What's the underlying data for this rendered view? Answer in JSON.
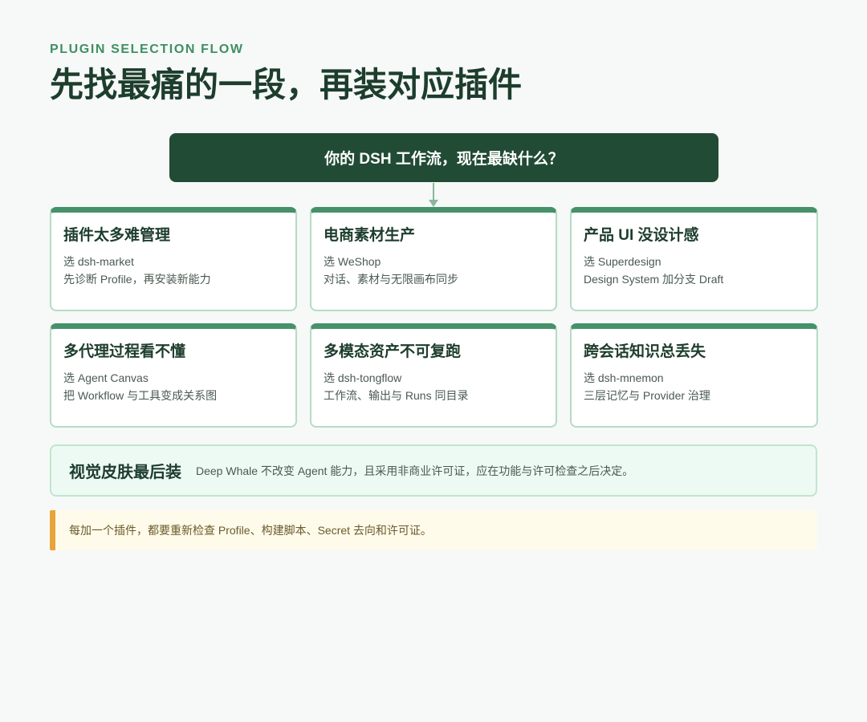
{
  "header": {
    "eyebrow": "PLUGIN SELECTION FLOW",
    "title": "先找最痛的一段，再装对应插件"
  },
  "question": "你的 DSH 工作流，现在最缺什么？",
  "cards": [
    {
      "title": "插件太多难管理",
      "line1": "选 dsh-market",
      "line2": "先诊断 Profile，再安装新能力"
    },
    {
      "title": "电商素材生产",
      "line1": "选 WeShop",
      "line2": "对话、素材与无限画布同步"
    },
    {
      "title": "产品 UI 没设计感",
      "line1": "选 Superdesign",
      "line2": "Design System 加分支 Draft"
    },
    {
      "title": "多代理过程看不懂",
      "line1": "选 Agent Canvas",
      "line2": "把 Workflow 与工具变成关系图"
    },
    {
      "title": "多模态资产不可复跑",
      "line1": "选 dsh-tongflow",
      "line2": "工作流、输出与 Runs 同目录"
    },
    {
      "title": "跨会话知识总丢失",
      "line1": "选 dsh-mnemon",
      "line2": "三层记忆与 Provider 治理"
    }
  ],
  "skin": {
    "title": "视觉皮肤最后装",
    "text": "Deep Whale 不改变 Agent 能力，且采用非商业许可证，应在功能与许可检查之后决定。"
  },
  "note": "每加一个插件，都要重新检查 Profile、构建脚本、Secret 去向和许可证。",
  "colors": {
    "accent_green": "#46916a",
    "dark_green": "#214b35",
    "note_orange": "#e8a33a"
  }
}
